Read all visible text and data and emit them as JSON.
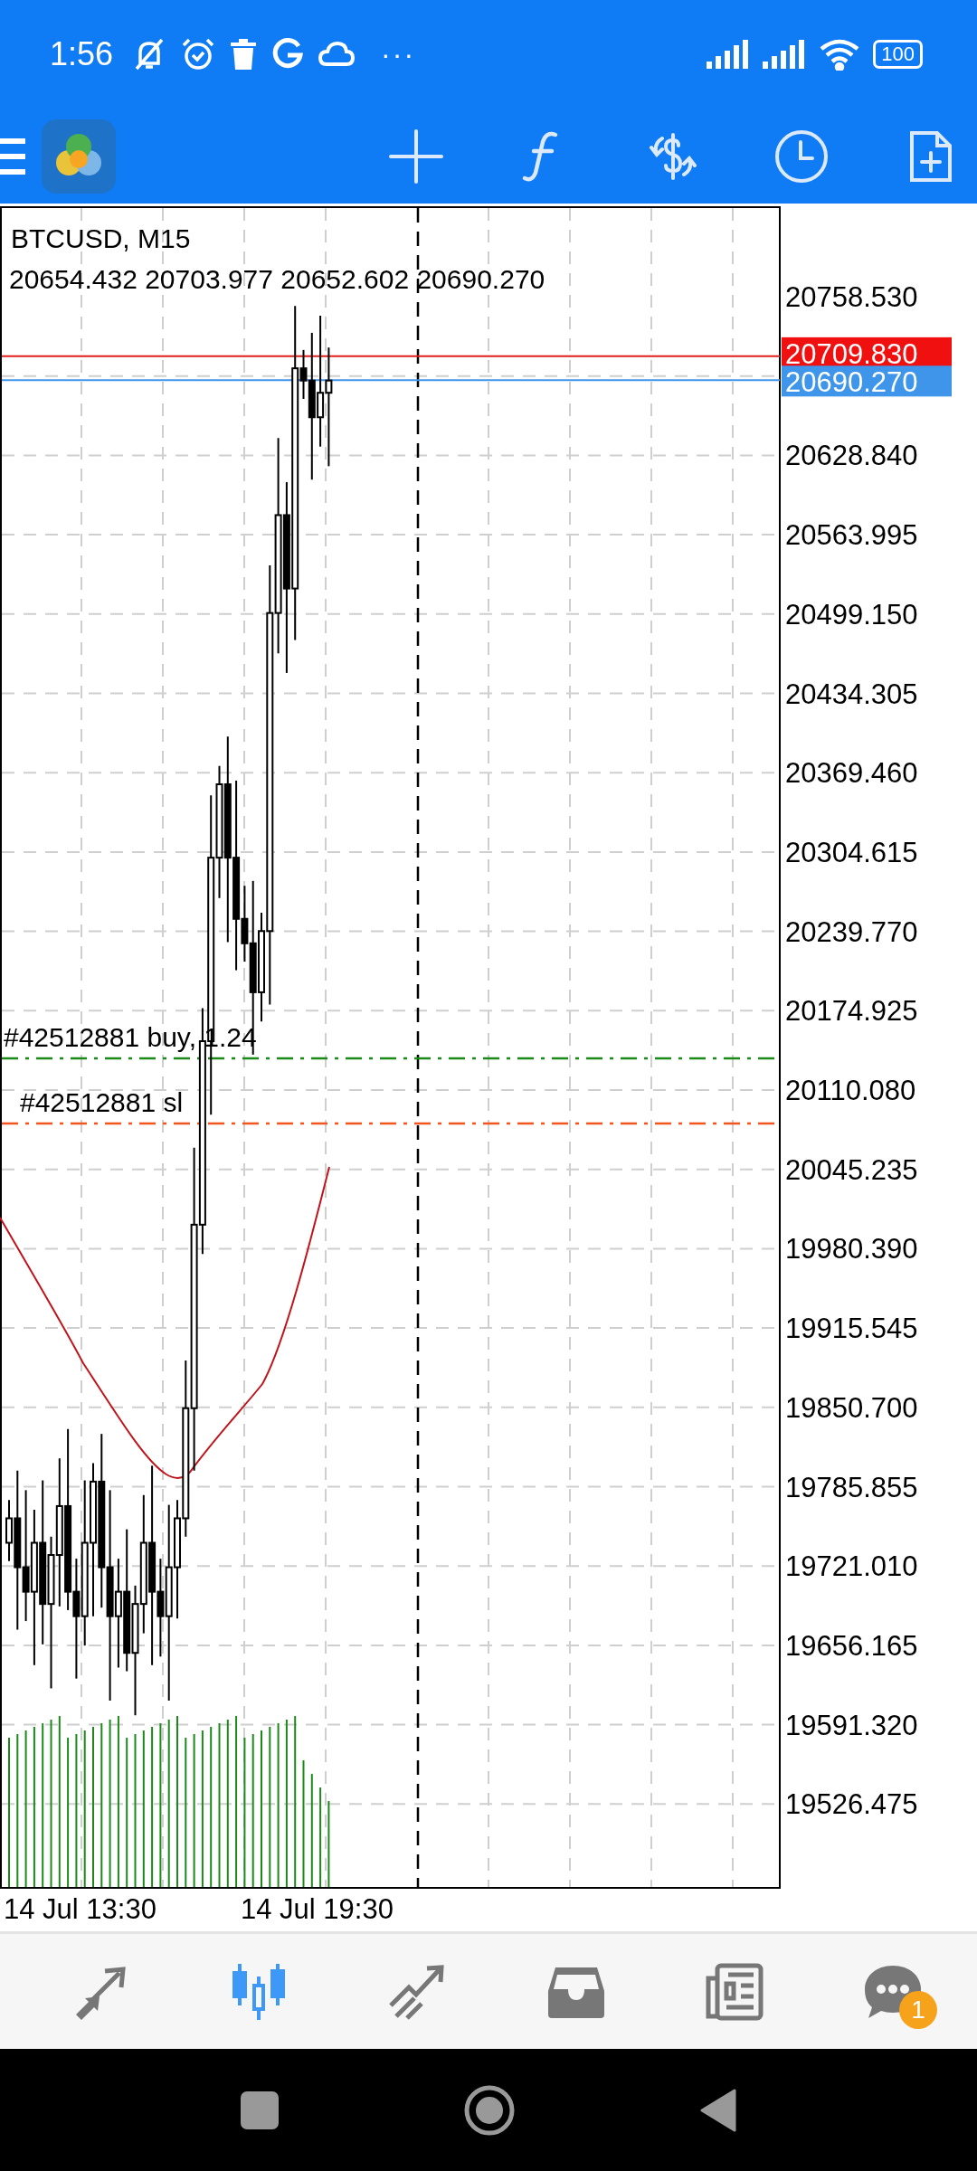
{
  "status_bar": {
    "time": "1:56",
    "more": "···",
    "battery": "100"
  },
  "chart": {
    "symbol": "BTCUSD, M15",
    "ohlc": "20654.432 20703.977 20652.602 20690.270",
    "price_scale": [
      "20758.530",
      "20628.840",
      "20563.995",
      "20499.150",
      "20434.305",
      "20369.460",
      "20304.615",
      "20239.770",
      "20174.925",
      "20110.080",
      "20045.235",
      "19980.390",
      "19915.545",
      "19850.700",
      "19785.855",
      "19721.010",
      "19656.165",
      "19591.320",
      "19526.475"
    ],
    "bid_label": "20709.830",
    "ask_label": "20690.270",
    "order_lines": [
      {
        "kind": "buy",
        "label": "#42512881 buy, 1.24"
      },
      {
        "kind": "sl",
        "label": "#42512881 sl"
      }
    ],
    "time_axis": [
      "14 Jul 13:30",
      "14 Jul 19:30"
    ]
  },
  "bottom_nav": [
    {
      "kind": "trade",
      "selected": false
    },
    {
      "kind": "chart",
      "selected": true
    },
    {
      "kind": "history",
      "selected": false
    },
    {
      "kind": "mailbox",
      "selected": false
    },
    {
      "kind": "news",
      "selected": false
    },
    {
      "kind": "chat",
      "selected": false,
      "badge": "1"
    }
  ]
}
